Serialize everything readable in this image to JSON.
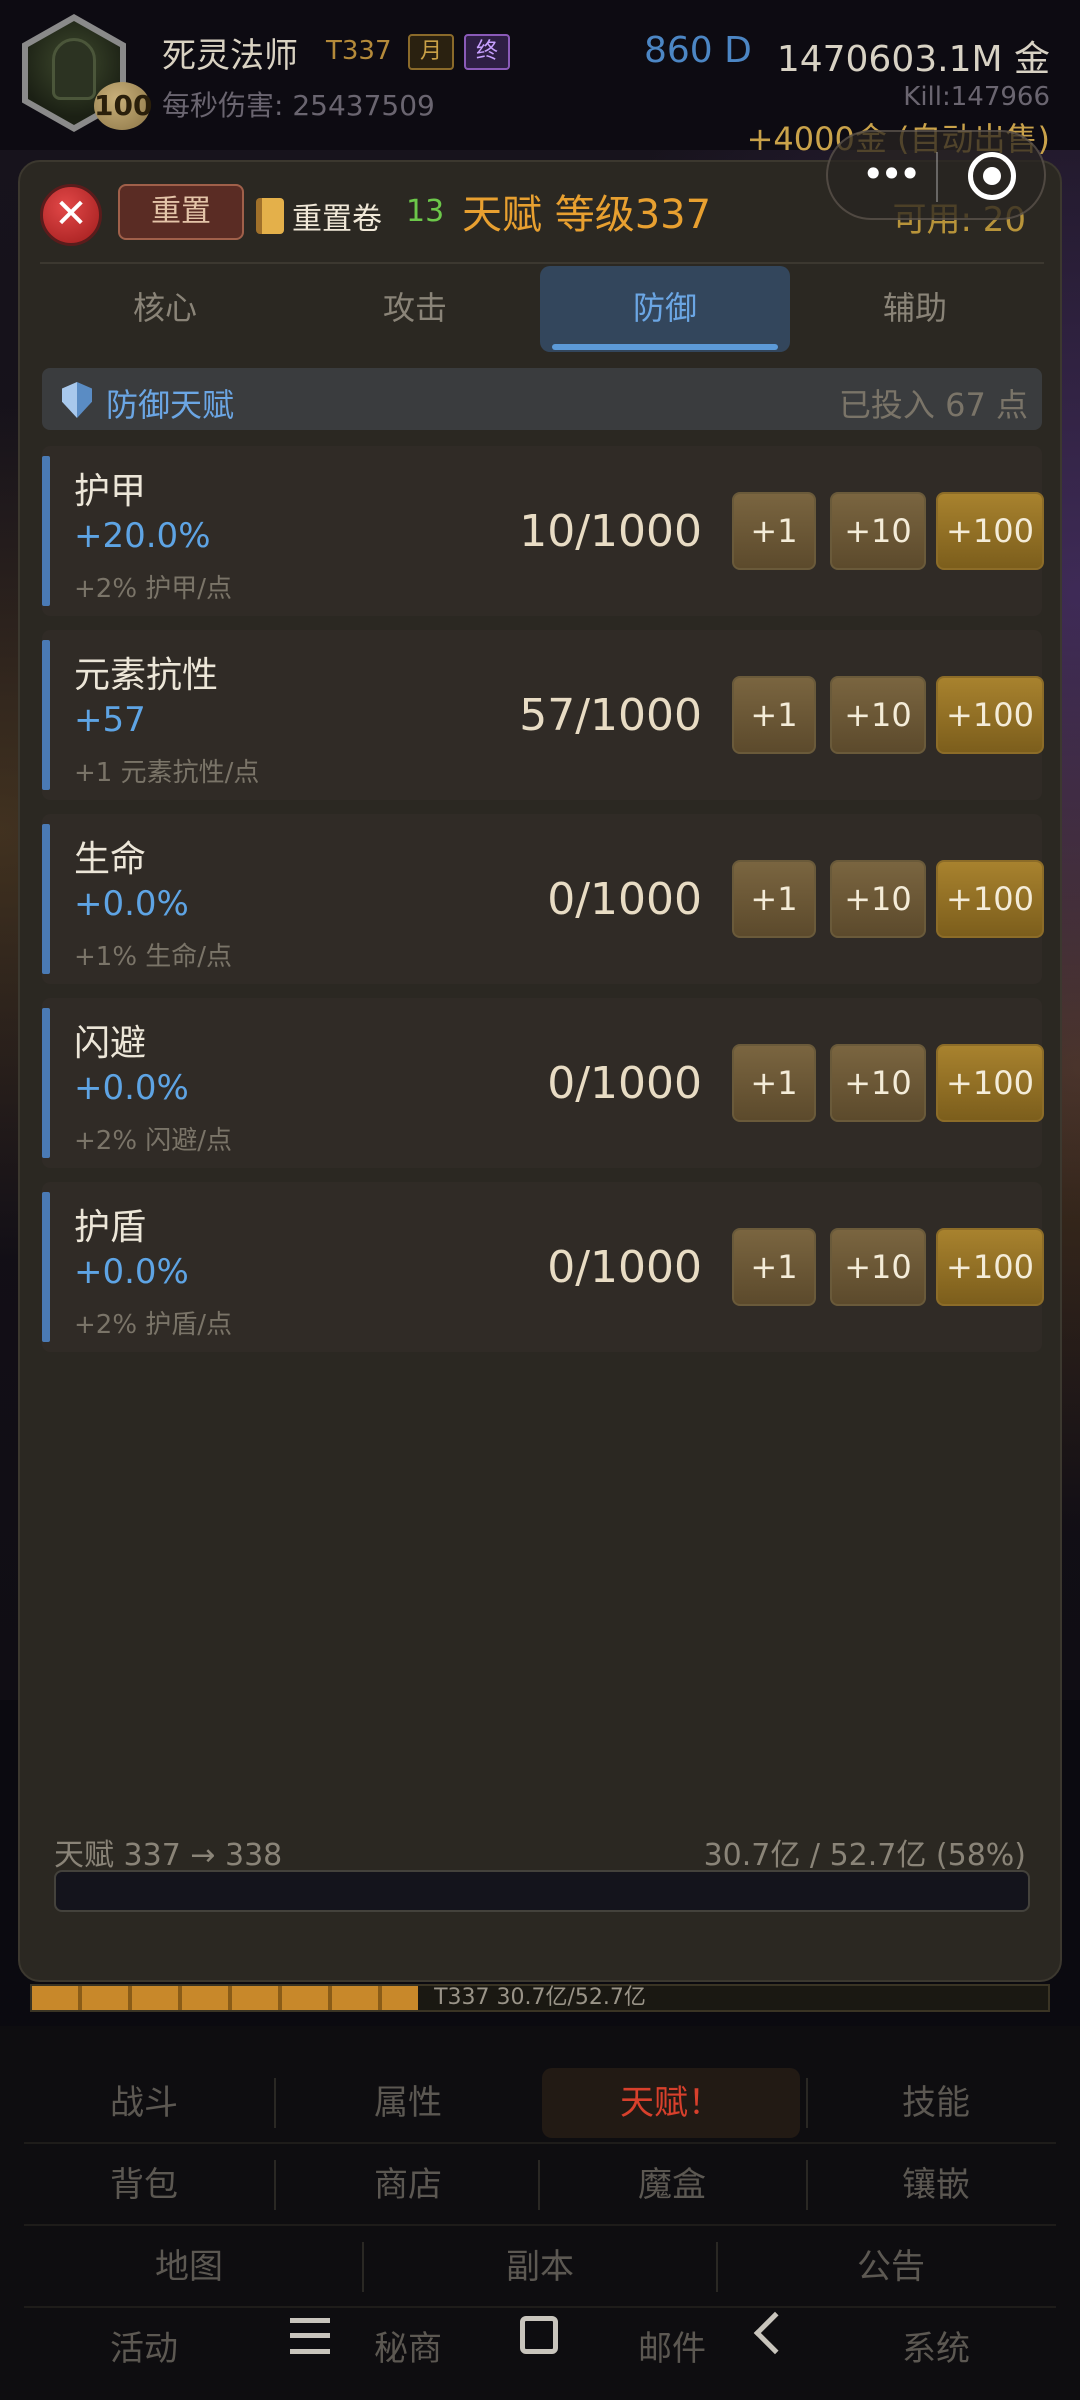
{
  "header": {
    "level_badge": "100",
    "character_name": "死灵法师",
    "tier": "T337",
    "tag_month": "月",
    "tag_end": "终",
    "dps": "每秒伤害: 25437509",
    "diamonds": "860 D",
    "gold": "1470603.1M 金",
    "kills": "Kill:147966",
    "gold_gain": "+4000金 (自动出售)"
  },
  "miniprogram": {
    "more_icon": "more-dots-icon",
    "close_icon": "target-close-icon"
  },
  "panel": {
    "close_glyph": "✕",
    "reset_label": "重置",
    "scroll_label": "重置卷",
    "scroll_count": "13",
    "title": "天赋 等级337",
    "available": "可用: 20",
    "tabs": [
      {
        "label": "核心"
      },
      {
        "label": "攻击"
      },
      {
        "label": "防御"
      },
      {
        "label": "辅助"
      }
    ],
    "active_tab": "防御",
    "section": {
      "icon": "shield-icon",
      "title": "防御天赋",
      "invested": "已投入 67 点"
    },
    "talents": [
      {
        "name": "护甲",
        "bonus": "+20.0%",
        "per_point": "+2% 护甲/点",
        "level": "10/1000"
      },
      {
        "name": "元素抗性",
        "bonus": "+57",
        "per_point": "+1 元素抗性/点",
        "level": "57/1000"
      },
      {
        "name": "生命",
        "bonus": "+0.0%",
        "per_point": "+1% 生命/点",
        "level": "0/1000"
      },
      {
        "name": "闪避",
        "bonus": "+0.0%",
        "per_point": "+2% 闪避/点",
        "level": "0/1000"
      },
      {
        "name": "护盾",
        "bonus": "+0.0%",
        "per_point": "+2% 护盾/点",
        "level": "0/1000"
      }
    ],
    "buttons": {
      "plus1": "+1",
      "plus10": "+10",
      "plus100": "+100"
    },
    "progress": {
      "label": "天赋 337 → 338",
      "stats": "30.7亿 / 52.7亿 (58%)",
      "fraction": 0.0
    }
  },
  "exp_bar": {
    "text": "T337 30.7亿/52.7亿",
    "fraction": 0.38
  },
  "nav": {
    "row1": [
      "战斗",
      "属性",
      "天赋！",
      "技能"
    ],
    "row2": [
      "背包",
      "商店",
      "魔盒",
      "镶嵌"
    ],
    "row3": [
      "地图",
      "副本",
      "公告"
    ],
    "row4": [
      "活动",
      "秘商",
      "邮件",
      "系统"
    ],
    "active": "天赋！"
  },
  "colors": {
    "accent_blue": "#6ba6e4",
    "title_orange": "#e8a030",
    "active_nav_red": "#d8402c"
  }
}
